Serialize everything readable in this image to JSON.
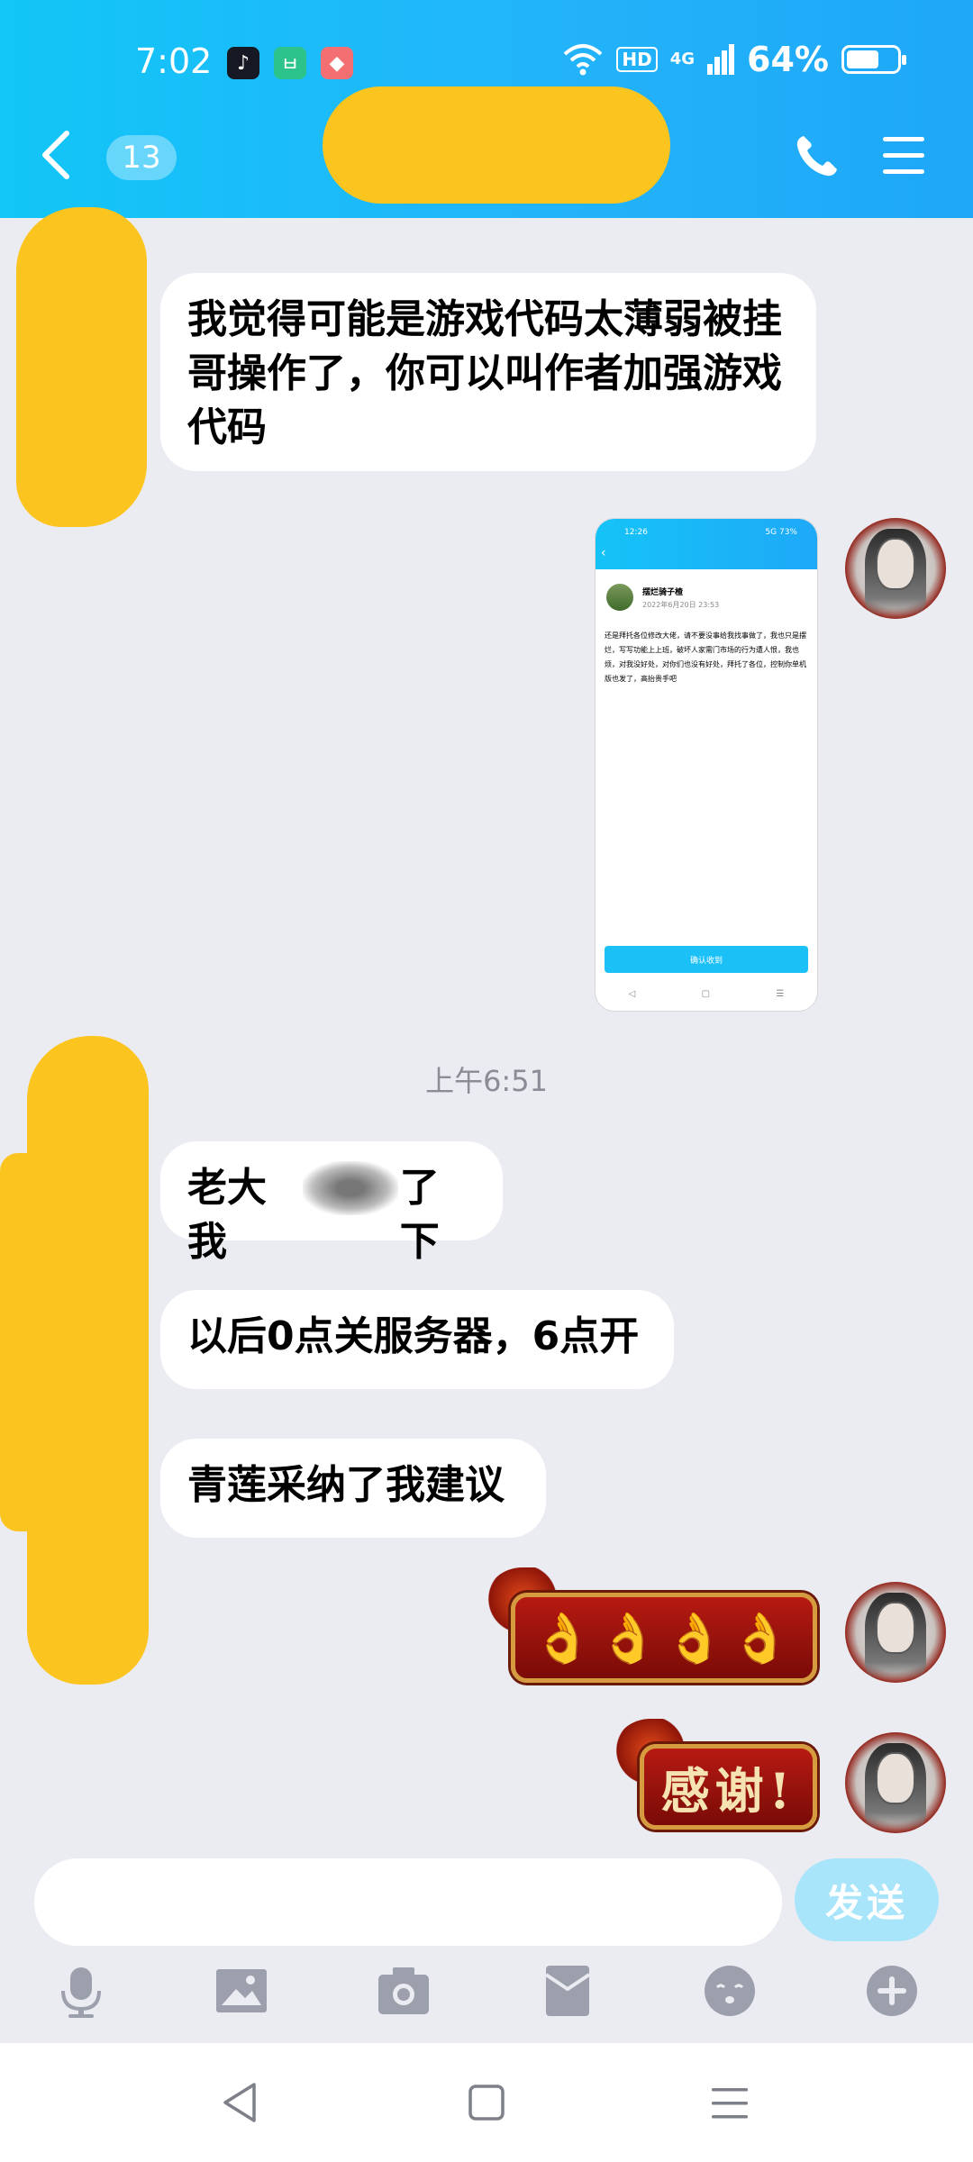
{
  "status_bar": {
    "time": "7:02",
    "hd": "HD",
    "network": "4G",
    "battery": "64%",
    "battery_level": 0.64
  },
  "header": {
    "unread_count": "13"
  },
  "chat": {
    "messages": [
      {
        "side": "left",
        "text": "我觉得可能是游戏代码太薄弱被挂哥操作了，你可以叫作者加强游戏代码"
      },
      {
        "side": "left",
        "text": "老大我"
      },
      {
        "side": "left",
        "text": "了下"
      },
      {
        "side": "left",
        "text": "以后0点关服务器，6点开"
      },
      {
        "side": "left",
        "text": "青莲采纳了我建议"
      },
      {
        "side": "right",
        "text": "👌👌👌👌"
      },
      {
        "side": "right",
        "text": "感谢!"
      }
    ],
    "time_label": "上午6:51",
    "shared_screenshot": {
      "time": "12:26",
      "status": "5G 73%",
      "name": "摆烂骑子楂",
      "date": "2022年6月20日 23:53",
      "text": "还是拜托各位修改大佬，请不要没事给我找事做了，我也只是摆烂，写写功能上上班，破坏人家需门市场的行为遭人恨，我也烦，对我没好处，对你们也没有好处，拜托了各位，控制你单机版也发了，高抬贵手吧",
      "button": "确认收到"
    }
  },
  "composer": {
    "send_label": "发送"
  },
  "toolbar": {
    "icons": [
      "microphone-icon",
      "image-icon",
      "camera-icon",
      "red-packet-icon",
      "emoji-icon",
      "plus-icon"
    ]
  },
  "colors": {
    "header": "#1EB4F9",
    "background": "#EBECF2",
    "redaction": "#FCC41E",
    "send": "#A8E4FA"
  }
}
